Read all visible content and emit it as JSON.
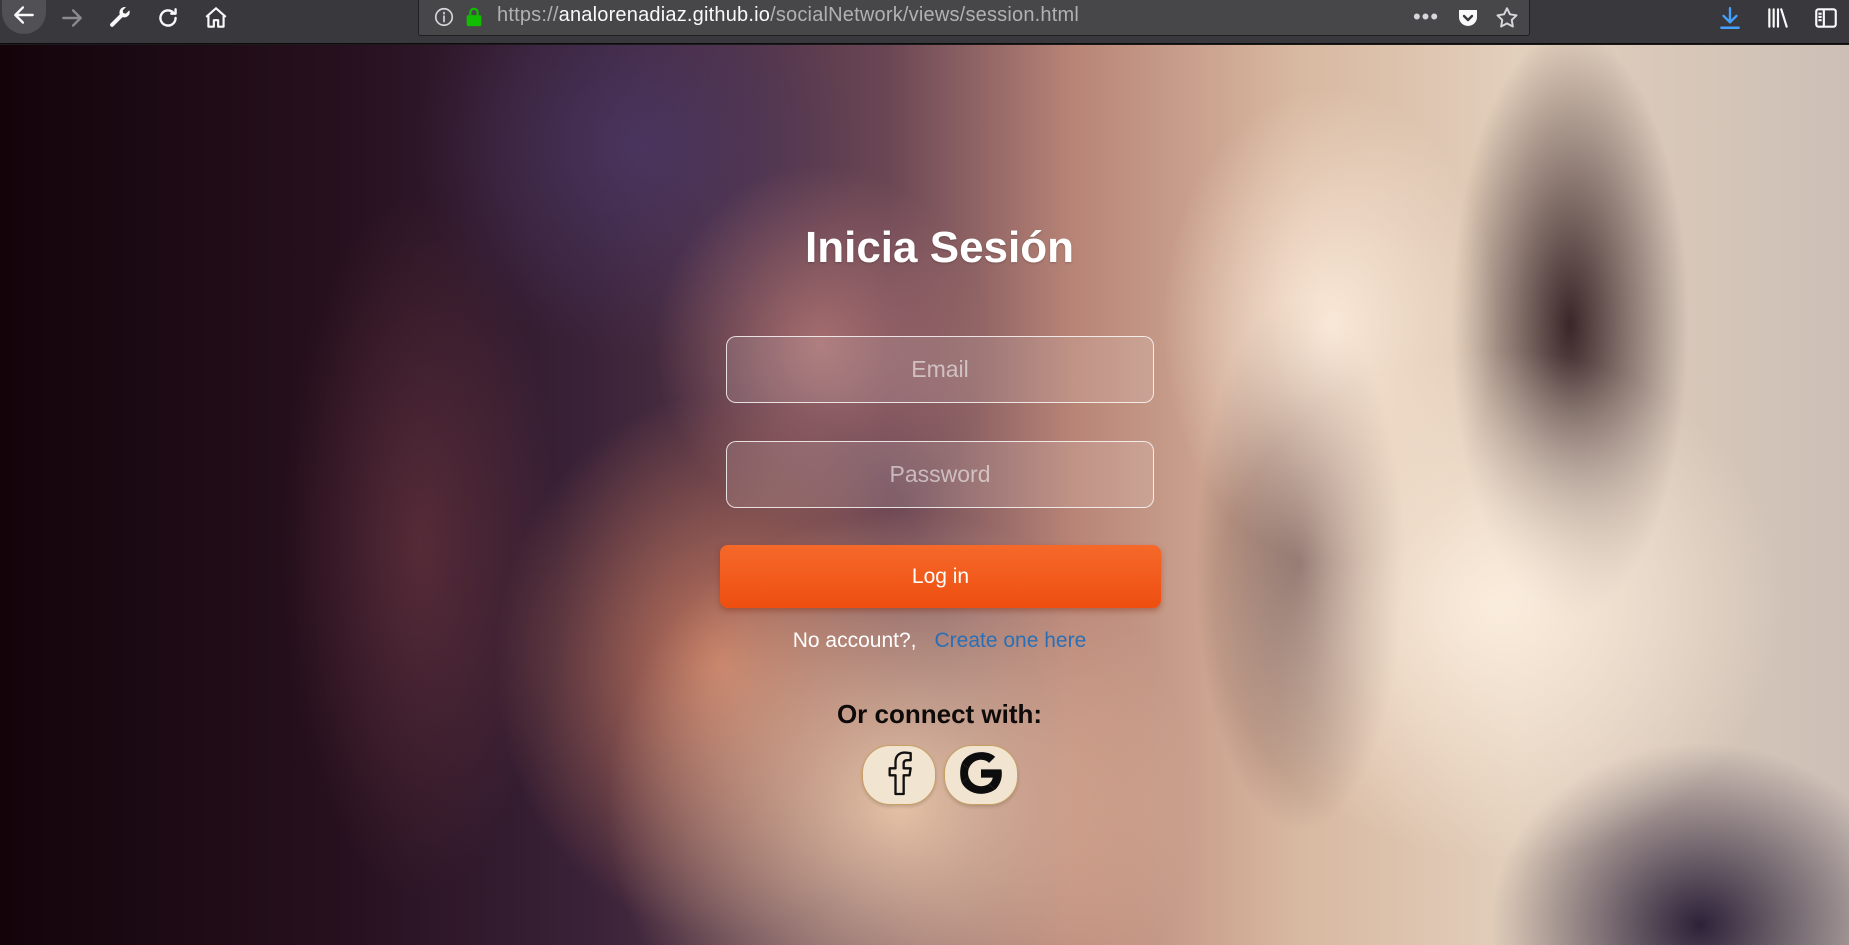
{
  "browser": {
    "url_scheme": "https://",
    "url_host": "analorenadiaz.github.io",
    "url_path": "/socialNetwork/views/session.html",
    "icons": {
      "back": "back-arrow-icon",
      "forward": "forward-arrow-icon",
      "tools": "wrench-icon",
      "reload": "reload-icon",
      "home": "home-icon",
      "info": "info-icon",
      "secure": "lock-icon",
      "page_actions": "more-dots-icon",
      "pocket": "pocket-icon",
      "bookmark": "star-icon",
      "downloads": "download-icon",
      "library": "library-icon",
      "sidebar": "sidebar-icon"
    },
    "colors": {
      "toolbar": "#38383d",
      "lock": "#12bc00",
      "download": "#45a1ff"
    }
  },
  "login": {
    "title": "Inicia Sesión",
    "email_placeholder": "Email",
    "password_placeholder": "Password",
    "login_button": "Log in",
    "no_account_text": "No account?,",
    "create_link": "Create one here",
    "connect_label": "Or connect with:",
    "social": [
      {
        "icon": "facebook-icon"
      },
      {
        "icon": "google-icon"
      }
    ],
    "colors": {
      "button": "#f05a1c",
      "link": "#2a6fb5",
      "title": "#ffffff"
    }
  }
}
